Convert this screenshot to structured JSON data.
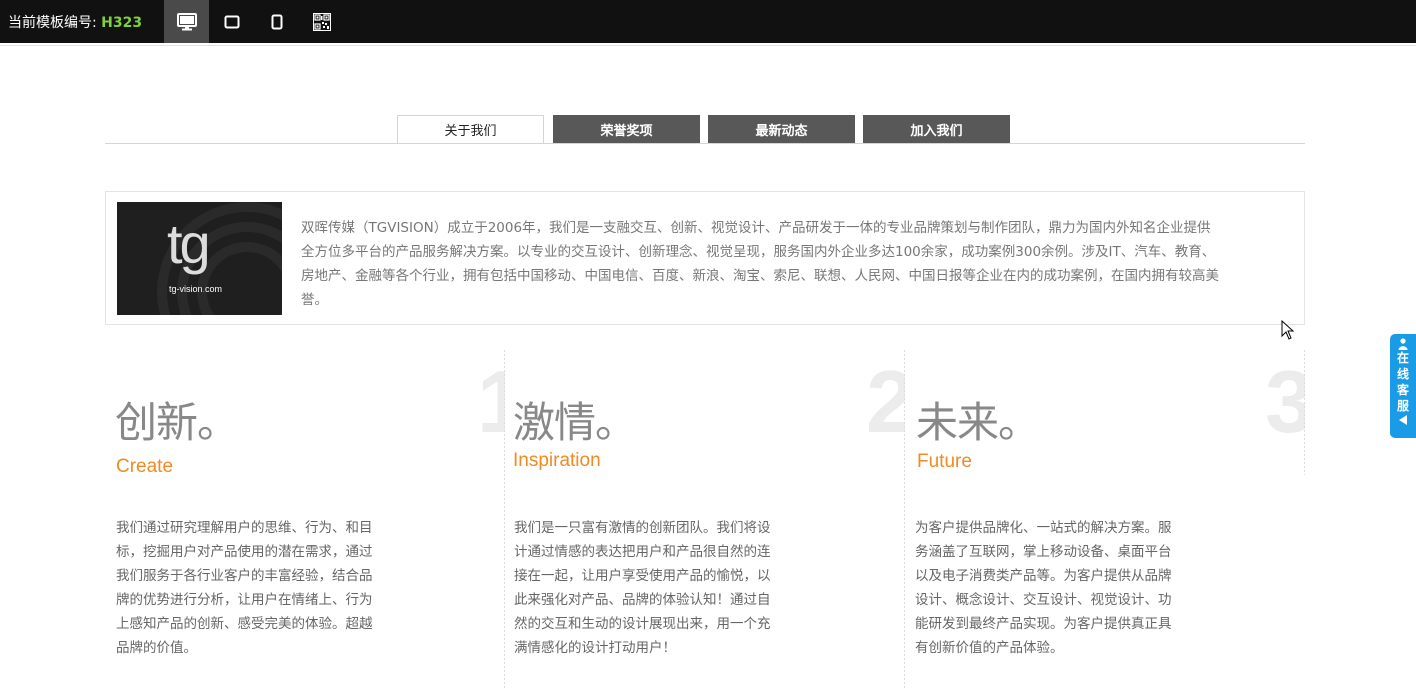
{
  "toolbar": {
    "template_label": "当前模板编号:",
    "template_code": "H323",
    "devices": [
      "desktop-icon",
      "tablet-landscape-icon",
      "tablet-portrait-icon",
      "qrcode-icon"
    ],
    "accent_color": "#7fd13b"
  },
  "tabs": [
    {
      "label": "关于我们",
      "active": true
    },
    {
      "label": "荣誉奖项",
      "active": false
    },
    {
      "label": "最新动态",
      "active": false
    },
    {
      "label": "加入我们",
      "active": false
    }
  ],
  "intro": {
    "logo_mark": "tg",
    "logo_url_prefix": "tg-vision",
    "logo_url_dot": ".",
    "logo_url_suffix": "com",
    "text": "双晖传媒（TGVISION）成立于2006年，我们是一支融交互、创新、视觉设计、产品研发于一体的专业品牌策划与制作团队，鼎力为国内外知名企业提供全方位多平台的产品服务解决方案。以专业的交互设计、创新理念、视觉呈现，服务国内外企业多达100余家，成功案例300余例。涉及IT、汽车、教育、房地产、金融等各个行业，拥有包括中国移动、中国电信、百度、新浪、淘宝、索尼、联想、人民网、中国日报等企业在内的成功案例，在国内拥有较高美誉。"
  },
  "columns": [
    {
      "number": "1",
      "title": "创新。",
      "en": "Create",
      "text": "我们通过研究理解用户的思维、行为、和目标，挖掘用户对产品使用的潜在需求，通过我们服务于各行业客户的丰富经验，结合品牌的优势进行分析，让用户在情绪上、行为上感知产品的创新、感受完美的体验。超越品牌的价值。"
    },
    {
      "number": "2",
      "title": "激情。",
      "en": "Inspiration",
      "text": "我们是一只富有激情的创新团队。我们将设计通过情感的表达把用户和产品很自然的连接在一起，让用户享受使用产品的愉悦，以此来强化对产品、品牌的体验认知！通过自然的交互和生动的设计展现出来，用一个充满情感化的设计打动用户！"
    },
    {
      "number": "3",
      "title": "未来。",
      "en": "Future",
      "text": "为客户提供品牌化、一站式的解决方案。服务涵盖了互联网，掌上移动设备、桌面平台以及电子消费类产品等。为客户提供从品牌设计、概念设计、交互设计、视觉设计、功能研发到最终产品实现。为客户提供真正具有创新价值的产品体验。"
    }
  ],
  "kefu": {
    "label": "在线客服",
    "color": "#1a9be6"
  },
  "colors": {
    "accent_orange": "#f08a24",
    "tab_inactive": "#585858"
  }
}
